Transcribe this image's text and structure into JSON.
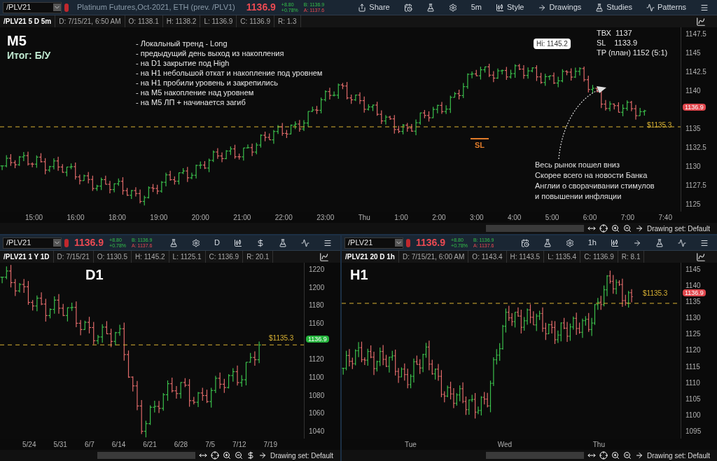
{
  "main": {
    "symbol": "/PLV21",
    "title": "Platinum Futures,Oct-2021, ETH (prev. /PLV1)",
    "price": "1136.9",
    "change": "+8.80",
    "change_pct": "+0.78%",
    "bid": "B: 1136.9",
    "ask": "A: 1137.6",
    "toolbar": [
      {
        "kind": "share",
        "label": "Share"
      },
      {
        "kind": "calendar"
      },
      {
        "kind": "flask"
      },
      {
        "kind": "gear"
      },
      {
        "kind": "text",
        "label": "5m"
      },
      {
        "kind": "style",
        "label": "Style"
      },
      {
        "kind": "arrow",
        "label": "Drawings"
      },
      {
        "kind": "flask",
        "label": "Studies"
      },
      {
        "kind": "patterns",
        "label": "Patterns"
      },
      {
        "kind": "menu"
      }
    ],
    "info": [
      "/PLV21 5 D 5m",
      "D: 7/15/21, 6:50 AM",
      "O: 1138.1",
      "H: 1138.2",
      "L: 1136.9",
      "C: 1136.9",
      "R: 1.3"
    ],
    "label": "M5",
    "result": "Итог: Б/У",
    "notes": [
      "- Локальный тренд - Long",
      "- предыдущий день выход из накопления",
      "- на D1 закрытие под High",
      "- на H1 небольшой откат и накопление под уровнем",
      "- на H1 пробили уровень и закрепились",
      "- на M5 накопление над уровнем",
      "- на M5 ЛП + начинается загиб"
    ],
    "trade": [
      "ТВХ  1137",
      "SL    1133.9",
      "TP (план) 1152 (5:1)"
    ],
    "hi_label": "Hi: 1145.2",
    "sl_label": "SL",
    "level_label": "$1135.3",
    "badge": {
      "text": "1136.9",
      "rising": false
    },
    "comment": [
      "Весь рынок пошел вниз",
      "Скорее всего на новости Банка",
      "Англии о сворачивании стимулов",
      "и повышении инфляции"
    ],
    "price_ticks": [
      "1147.5",
      "1145",
      "1142.5",
      "1140",
      "1135",
      "1132.5",
      "1130",
      "1127.5",
      "1125"
    ],
    "time_labels": [
      "15:00",
      "16:00",
      "18:00",
      "19:00",
      "20:00",
      "21:00",
      "22:00",
      "23:00",
      "Thu",
      "1:00",
      "2:00",
      "3:00",
      "4:00",
      "5:00",
      "6:00",
      "7:00",
      "7:40"
    ],
    "drawing_set": "Drawing set: Default"
  },
  "d1": {
    "symbol": "/PLV21",
    "price": "1136.9",
    "change": "+8.80",
    "change_pct": "+0.78%",
    "bid": "B: 1136.9",
    "ask": "A: 1137.6",
    "toolbar": [
      {
        "kind": "flask"
      },
      {
        "kind": "gear"
      },
      {
        "kind": "text",
        "label": "D"
      },
      {
        "kind": "candles"
      },
      {
        "kind": "dollar"
      },
      {
        "kind": "flask"
      },
      {
        "kind": "patterns"
      },
      {
        "kind": "menu"
      }
    ],
    "info": [
      "/PLV21 1 Y 1D",
      "D: 7/15/21",
      "O: 1130.5",
      "H: 1145.2",
      "L: 1125.1",
      "C: 1136.9",
      "R: 20.1"
    ],
    "label": "D1",
    "level_label": "$1135.3",
    "badge": {
      "text": "1136.9",
      "rising": true
    },
    "price_ticks": [
      "1220",
      "1200",
      "1180",
      "1160",
      "1120",
      "1100",
      "1080",
      "1060",
      "1040"
    ],
    "time_labels": [
      "5/24",
      "5/31",
      "6/7",
      "6/14",
      "6/21",
      "6/28",
      "7/5",
      "7/12",
      "7/19"
    ],
    "drawing_set": "Drawing set: Default"
  },
  "h1": {
    "symbol": "/PLV21",
    "price": "1136.9",
    "change": "+8.80",
    "change_pct": "+0.78%",
    "bid": "B: 1136.9",
    "ask": "A: 1137.6",
    "toolbar": [
      {
        "kind": "calendar"
      },
      {
        "kind": "flask"
      },
      {
        "kind": "gear"
      },
      {
        "kind": "text",
        "label": "1h"
      },
      {
        "kind": "candles"
      },
      {
        "kind": "arrow"
      },
      {
        "kind": "flask"
      },
      {
        "kind": "patterns"
      },
      {
        "kind": "menu"
      }
    ],
    "info": [
      "/PLV21 20 D 1h",
      "D: 7/15/21, 6:00 AM",
      "O: 1143.4",
      "H: 1143.5",
      "L: 1135.4",
      "C: 1136.9",
      "R: 8.1"
    ],
    "label": "H1",
    "level_label": "$1135.3",
    "badge": {
      "text": "1136.9",
      "rising": false
    },
    "price_ticks": [
      "1145",
      "1140",
      "1135",
      "1130",
      "1125",
      "1120",
      "1115",
      "1110",
      "1105",
      "1100",
      "1095"
    ],
    "time_labels": [
      "Tue",
      "Wed",
      "Thu"
    ],
    "drawing_set": "Drawing set: Default"
  }
}
